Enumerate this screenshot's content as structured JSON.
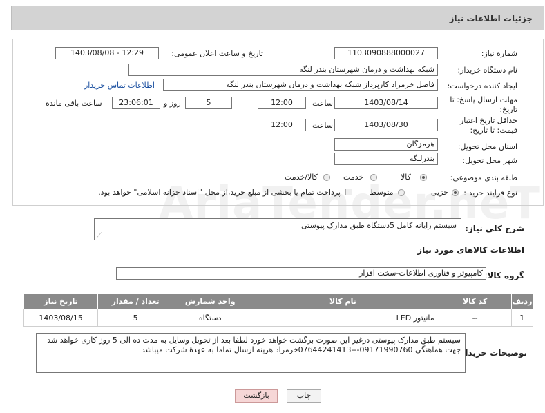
{
  "header": {
    "title": "جزئیات اطلاعات نیاز"
  },
  "form": {
    "need_number_label": "شماره نیاز:",
    "need_number": "1103090888000027",
    "announce_label": "تاریخ و ساعت اعلان عمومی:",
    "announce_value": "1403/08/08 - 12:29",
    "buyer_org_label": "نام دستگاه خریدار:",
    "buyer_org": "شبکه بهداشت و درمان شهرستان بندر لنگه",
    "requester_label": "ایجاد کننده درخواست:",
    "requester": "فاضل خرمزاد کارپرداز شبکه بهداشت و درمان شهرستان بندر لنگه",
    "contact_link": "اطلاعات تماس خریدار",
    "deadline_label": "مهلت ارسال پاسخ: تا تاریخ:",
    "deadline_date": "1403/08/14",
    "time_label": "ساعت",
    "deadline_time": "12:00",
    "days_value": "5",
    "days_label": "روز و",
    "remaining_time": "23:06:01",
    "remaining_label": "ساعت باقی مانده",
    "min_validity_label": "حداقل تاریخ اعتبار قیمت: تا تاریخ:",
    "validity_date": "1403/08/30",
    "validity_time_label": "ساعت",
    "validity_time": "12:00",
    "province_label": "استان محل تحویل:",
    "province": "هرمزگان",
    "city_label": "شهر محل تحویل:",
    "city": "بندرلنگه",
    "category_label": "طبقه بندی موضوعی:",
    "category_options": [
      "کالا",
      "خدمت",
      "کالا/خدمت"
    ],
    "process_label": "نوع فرآیند خرید :",
    "process_options": [
      "جزیی",
      "متوسط"
    ],
    "payment_note": "پرداخت تمام یا بخشی از مبلغ خرید،از محل \"اسناد خزانه اسلامی\" خواهد بود."
  },
  "summary": {
    "label": "شرح کلی نیاز:",
    "value": "سیستم رایانه کامل 5دستگاه  طبق مدارک پیوستی"
  },
  "goods": {
    "section_title": "اطلاعات کالاهای مورد نیاز",
    "group_label": "گروه کالا:",
    "group_value": "کامپیوتر و فناوری اطلاعات-سخت افزار",
    "columns": [
      "ردیف",
      "کد کالا",
      "نام کالا",
      "واحد شمارش",
      "تعداد / مقدار",
      "تاریخ نیاز"
    ],
    "rows": [
      {
        "index": "1",
        "code": "--",
        "name": "مانیتور LED",
        "unit": "دستگاه",
        "qty": "5",
        "date": "1403/08/15"
      }
    ]
  },
  "buyer_notes": {
    "label": "توضیحات خریدار:",
    "text": "سیستم طبق مدارک پیوستی درغیر این صورت برگشت خواهد خورد لطفا بعد از تحویل وسایل به مدت ده الی 5 روز کاری خواهد شد جهت هماهنگی 09171990760---07644241413خرمزاد هزینه ارسال تماما به عهدهٔ شرکت میباشد"
  },
  "buttons": {
    "print": "چاپ",
    "back": "بازگشت"
  },
  "watermark": "AriaTender.neT",
  "colors": {
    "header_bg": "#d3d3d3",
    "table_header_bg": "#8a8a8a",
    "link": "#1a4fa0",
    "back_button_bg": "#f6d6d6"
  }
}
